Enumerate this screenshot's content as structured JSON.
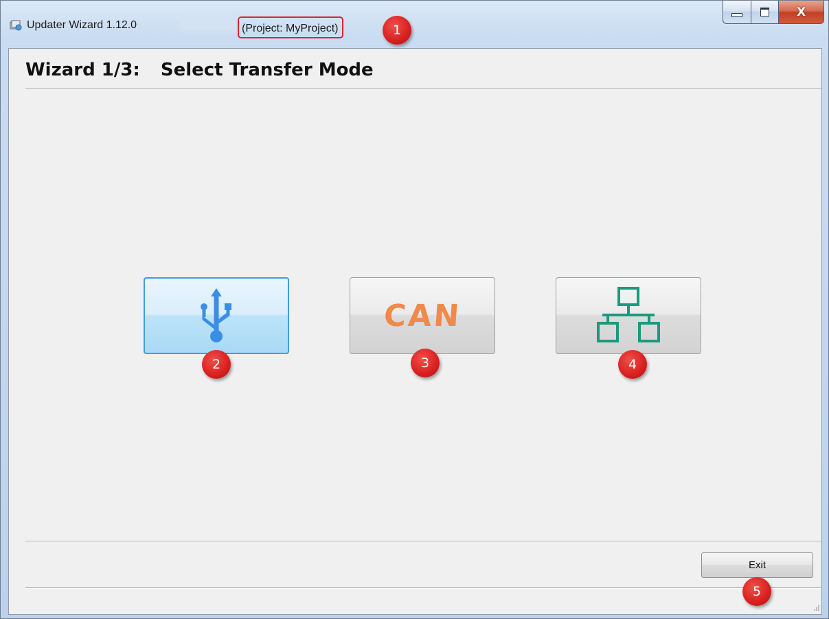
{
  "window": {
    "title": "Updater Wizard 1.12.0",
    "project": "(Project: MyProject)",
    "controls": {
      "minimize_icon": "minimize-icon",
      "maximize_icon": "maximize-icon",
      "close_glyph": "X"
    }
  },
  "wizard": {
    "step": "Wizard 1/3:",
    "title": "Select Transfer Mode"
  },
  "transfer_modes": [
    {
      "id": "usb",
      "icon": "usb-icon",
      "color": "#3a8ee6",
      "selected": true
    },
    {
      "id": "can",
      "label": "CAN",
      "color": "#f08a4b",
      "selected": false
    },
    {
      "id": "ethernet",
      "icon": "network-icon",
      "color": "#1a9a7e",
      "selected": false
    }
  ],
  "footer": {
    "exit_label": "Exit"
  },
  "markers": [
    "1",
    "2",
    "3",
    "4",
    "5"
  ],
  "colors": {
    "marker": "#d81f1f",
    "selection": "#3c9fdf",
    "highlight_box": "#e02330"
  }
}
